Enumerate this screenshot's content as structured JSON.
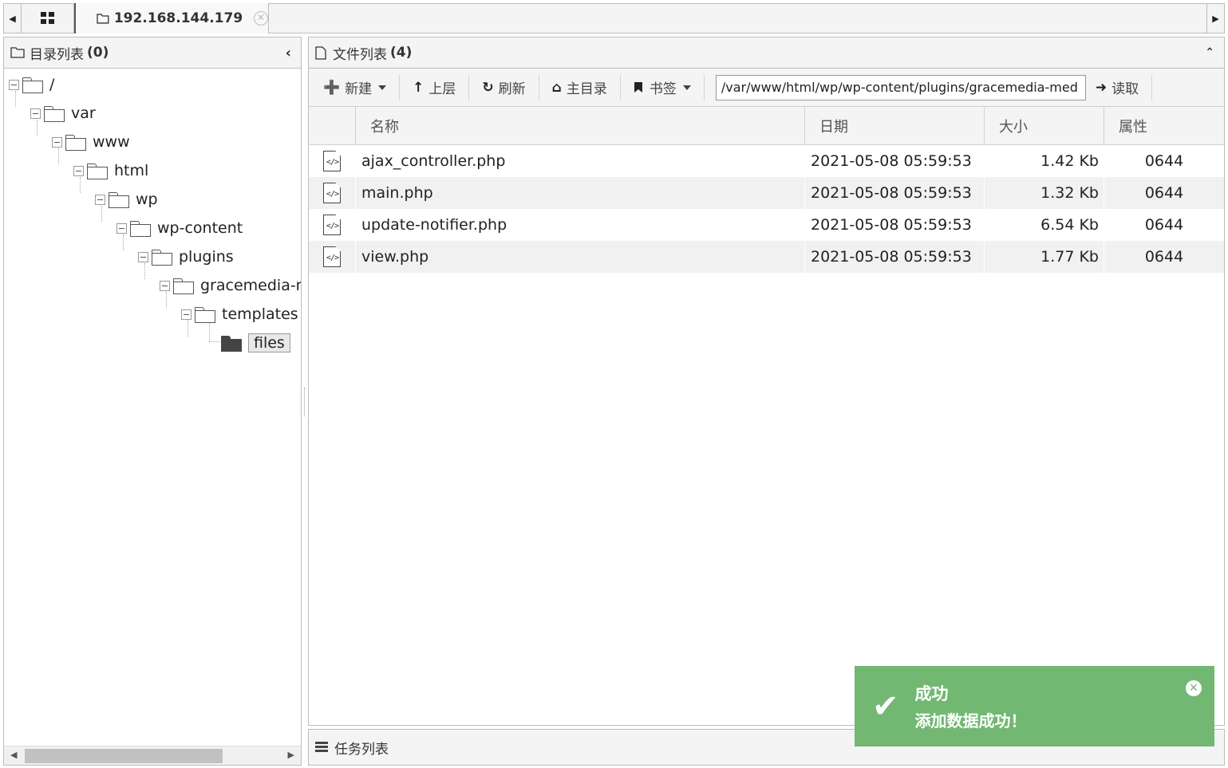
{
  "tabbar": {
    "home_icon": "grid-icon",
    "active_tab": {
      "label": "192.168.144.179",
      "icon": "folder-icon",
      "close_icon": "close-icon"
    }
  },
  "dir_panel": {
    "title": "目录列表",
    "count": "(0)",
    "tree": [
      {
        "label": "/",
        "depth": 0
      },
      {
        "label": "var",
        "depth": 1
      },
      {
        "label": "www",
        "depth": 2
      },
      {
        "label": "html",
        "depth": 3
      },
      {
        "label": "wp",
        "depth": 4
      },
      {
        "label": "wp-content",
        "depth": 5
      },
      {
        "label": "plugins",
        "depth": 6
      },
      {
        "label": "gracemedia-m",
        "depth": 7
      },
      {
        "label": "templates",
        "depth": 8
      },
      {
        "label": "files",
        "depth": 9,
        "selected": true
      }
    ]
  },
  "file_panel": {
    "title": "文件列表",
    "count": "(4)",
    "toolbar": {
      "new": "新建",
      "up": "上层",
      "refresh": "刷新",
      "home": "主目录",
      "bookmark": "书签",
      "path": "/var/www/html/wp/wp-content/plugins/gracemedia-med",
      "read": "读取"
    },
    "columns": {
      "name": "名称",
      "date": "日期",
      "size": "大小",
      "attr": "属性"
    },
    "files": [
      {
        "name": "ajax_controller.php",
        "date": "2021-05-08 05:59:53",
        "size": "1.42 Kb",
        "attr": "0644"
      },
      {
        "name": "main.php",
        "date": "2021-05-08 05:59:53",
        "size": "1.32 Kb",
        "attr": "0644"
      },
      {
        "name": "update-notifier.php",
        "date": "2021-05-08 05:59:53",
        "size": "6.54 Kb",
        "attr": "0644"
      },
      {
        "name": "view.php",
        "date": "2021-05-08 05:59:53",
        "size": "1.77 Kb",
        "attr": "0644"
      }
    ]
  },
  "task_panel": {
    "title": "任务列表"
  },
  "toast": {
    "title": "成功",
    "message": "添加数据成功！",
    "color": "#72b872"
  }
}
